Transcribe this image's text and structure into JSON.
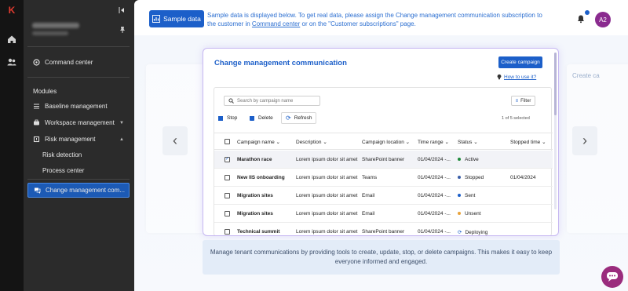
{
  "colors": {
    "accent": "#1c5fc9",
    "active_nav": "#1c5ab5",
    "avatar": "#8a2b8f",
    "status_active": "#1f8a3a",
    "status_sent": "#1c5fc9",
    "status_unsent": "#e8a33b",
    "status_stopped": "#3a5ea8"
  },
  "rail": {
    "logo": "K",
    "icons": [
      "home-icon",
      "people-icon"
    ]
  },
  "sidebar": {
    "command_center": "Command center",
    "modules_label": "Modules",
    "items": [
      {
        "label": "Baseline management"
      },
      {
        "label": "Workspace management"
      },
      {
        "label": "Risk management"
      },
      {
        "label": "Risk detection"
      },
      {
        "label": "Process center"
      },
      {
        "label": "Change management com..."
      }
    ]
  },
  "banner": {
    "button": "Sample data",
    "text_before": "Sample data is displayed below. To get real data, please assign the Change management communication subscription to the customer in ",
    "link": "Command center",
    "text_after": " or on the \"Customer subscriptions\" page."
  },
  "header": {
    "avatar": "A2"
  },
  "ghost": {
    "title": "Create ca"
  },
  "card": {
    "title": "Change management communication",
    "create_button": "Create campaign",
    "howto": "How to use it?",
    "search_placeholder": "Search by campaign name",
    "filter": "Filter",
    "toolbar": {
      "stop": "Stop",
      "delete": "Delete",
      "refresh": "Refresh"
    },
    "selection": "1 of 5 selected",
    "columns": [
      "Campaign name",
      "Description",
      "Campaign location",
      "Time range",
      "Status",
      "Stopped time"
    ],
    "rows": [
      {
        "name": "Marathon race",
        "description": "Lorem ipsum dolor sit amet",
        "location": "SharePoint banner",
        "time": "01/04/2024 -...",
        "status": "Active",
        "stopped": "",
        "checked": true
      },
      {
        "name": "New IIS onboarding",
        "description": "Lorem ipsum dolor sit amet",
        "location": "Teams",
        "time": "01/04/2024 -...",
        "status": "Stopped",
        "stopped": "01/04/2024",
        "checked": false
      },
      {
        "name": "Migration sites",
        "description": "Lorem ipsum dolor sit amet",
        "location": "Email",
        "time": "01/04/2024 -...",
        "status": "Sent",
        "stopped": "",
        "checked": false
      },
      {
        "name": "Migration sites",
        "description": "Lorem ipsum dolor sit amet",
        "location": "Email",
        "time": "01/04/2024 -...",
        "status": "Unsent",
        "stopped": "",
        "checked": false
      },
      {
        "name": "Technical summit",
        "description": "Lorem ipsum dolor sit amet",
        "location": "SharePoint banner",
        "time": "01/04/2024 -...",
        "status": "Deploying",
        "stopped": "",
        "checked": false
      }
    ]
  },
  "description": "Manage tenant communications by providing tools to create, update, stop, or delete campaigns. This makes it easy to keep everyone informed and engaged."
}
